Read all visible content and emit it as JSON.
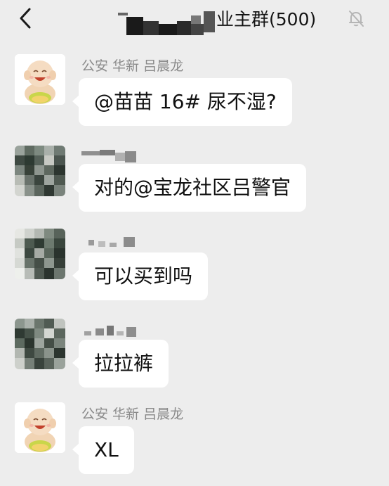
{
  "header": {
    "back_icon": "chevron-left-icon",
    "title_suffix": "业主群(500)",
    "mute_icon": "bell-muted-icon"
  },
  "messages": [
    {
      "sender": "公安 华新 吕晨龙",
      "text": "@苗苗 16#  尿不湿?",
      "avatar": "buddha-avatar"
    },
    {
      "sender": "",
      "text": "对的@宝龙社区吕警官",
      "avatar": "pixelated-avatar"
    },
    {
      "sender": "",
      "text": "可以买到吗",
      "avatar": "pixelated-avatar"
    },
    {
      "sender": "",
      "text": "拉拉裤",
      "avatar": "pixelated-avatar"
    },
    {
      "sender": "公安 华新 吕晨龙",
      "text": "XL",
      "avatar": "buddha-avatar"
    }
  ],
  "colors": {
    "background": "#ededed",
    "bubble": "#ffffff",
    "sender_text": "#8a8a8a"
  }
}
